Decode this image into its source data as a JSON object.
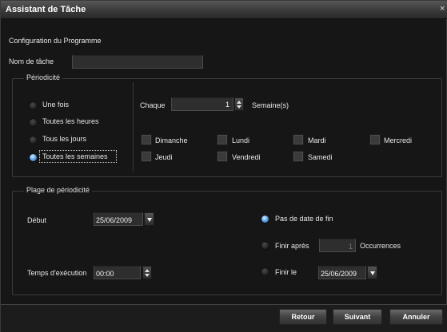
{
  "window": {
    "title": "Assistant de Tâche",
    "close_glyph": "×"
  },
  "config": {
    "heading": "Configuration du Programme",
    "task_name_label": "Nom de tâche",
    "task_name_value": ""
  },
  "periodicity": {
    "legend": "Périodicité",
    "options": [
      "Une fois",
      "Toutes les heures",
      "Tous les jours",
      "Toutes les semaines"
    ],
    "selected": "Toutes les semaines",
    "every_label": "Chaque",
    "every_value": "1",
    "unit_label": "Semaine(s)",
    "days": [
      "Dimanche",
      "Lundi",
      "Mardi",
      "Mercredi",
      "Jeudi",
      "Vendredi",
      "Samedi"
    ]
  },
  "range": {
    "legend": "Plage de périodicité",
    "start_label": "Début",
    "start_value": "25/06/2009",
    "exec_time_label": "Temps d'exécution",
    "exec_time_value": "00:00",
    "no_end_label": "Pas de date de fin",
    "finish_after_label": "Finir après",
    "occurrences_value": "1",
    "occurrences_label": "Occurrences",
    "finish_on_label": "Finir le",
    "finish_on_value": "25/06/2009",
    "selected": "Pas de date de fin"
  },
  "footer": {
    "back_label": "Retour",
    "next_label": "Suivant",
    "cancel_label": "Annuler"
  },
  "colors": {
    "accent_radio": "#4f9be6",
    "background": "#161616",
    "titlebar": "#3a3a3a"
  }
}
